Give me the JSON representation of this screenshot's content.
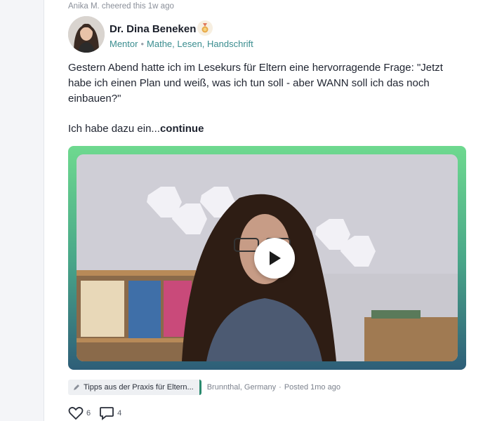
{
  "activity": "Anika M. cheered this 1w ago",
  "author": {
    "name": "Dr. Dina Beneken",
    "role": "Mentor",
    "topics": "Mathe, Lesen, Handschrift",
    "badge_icon": "medal-icon"
  },
  "post": {
    "paragraph1": "Gestern Abend hatte ich im Lesekurs für Eltern eine hervorragende Frage: \"Jetzt habe ich einen Plan und weiß, was ich tun soll - aber WANN soll ich das noch einbauen?\"",
    "paragraph2": "Ich habe dazu ein...",
    "continue_label": "continue"
  },
  "video": {
    "play_icon": "play-icon",
    "frame_gradient": [
      "#6ed98f",
      "#4aa889",
      "#2e5e78"
    ]
  },
  "footer": {
    "category": "Tipps aus der Praxis für Eltern...",
    "location": "Brunnthal, Germany",
    "posted": "Posted 1mo ago"
  },
  "reactions": {
    "likes": "6",
    "comments": "4"
  },
  "colors": {
    "accent": "#3a8d8f",
    "category_bar": "#2a8a6e"
  }
}
